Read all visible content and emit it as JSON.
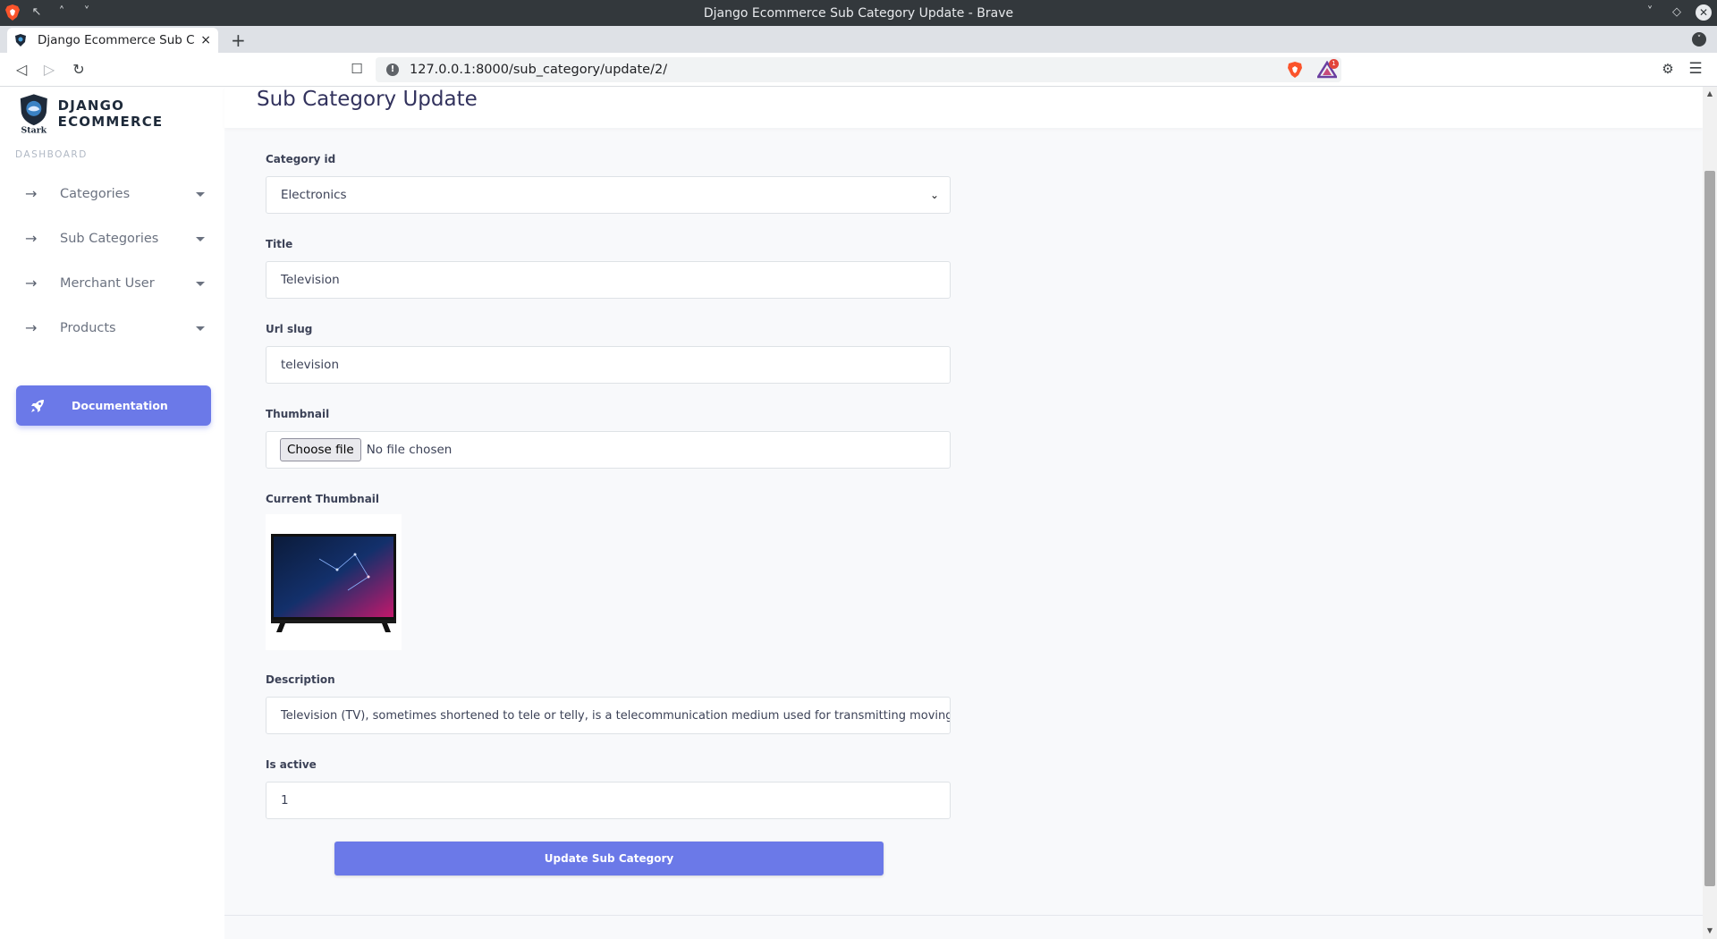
{
  "window": {
    "title": "Django Ecommerce Sub Category Update - Brave"
  },
  "tab": {
    "title": "Django Ecommerce Sub Cat",
    "close": "×",
    "new_tab": "+"
  },
  "address_bar": {
    "url": "127.0.0.1:8000/sub_category/update/2/",
    "rewards_count": "1"
  },
  "sidebar": {
    "brand": "DJANGO ECOMMERCE",
    "section_label": "DASHBOARD",
    "items": [
      {
        "label": "Categories"
      },
      {
        "label": "Sub Categories"
      },
      {
        "label": "Merchant User"
      },
      {
        "label": "Products"
      }
    ],
    "documentation_label": "Documentation"
  },
  "main": {
    "page_title": "Sub Category Update",
    "form": {
      "category_id_label": "Category id",
      "category_id_value": "Electronics",
      "title_label": "Title",
      "title_value": "Television",
      "url_slug_label": "Url slug",
      "url_slug_value": "television",
      "thumbnail_label": "Thumbnail",
      "file_button": "Choose file",
      "file_status": "No file chosen",
      "current_thumbnail_label": "Current Thumbnail",
      "description_label": "Description",
      "description_value": "Television (TV), sometimes shortened to tele or telly, is a telecommunication medium used for transmitting moving ima",
      "is_active_label": "Is active",
      "is_active_value": "1",
      "submit_label": "Update Sub Category"
    }
  },
  "colors": {
    "accent": "#6b79e8",
    "title_text": "#32325d",
    "sidebar_text": "#6b7280"
  },
  "icons": {
    "nav_arrow": "arrow-right-icon",
    "nav_caret": "caret-down-icon",
    "documentation": "rocket-icon",
    "thumbnail": "television-image"
  }
}
